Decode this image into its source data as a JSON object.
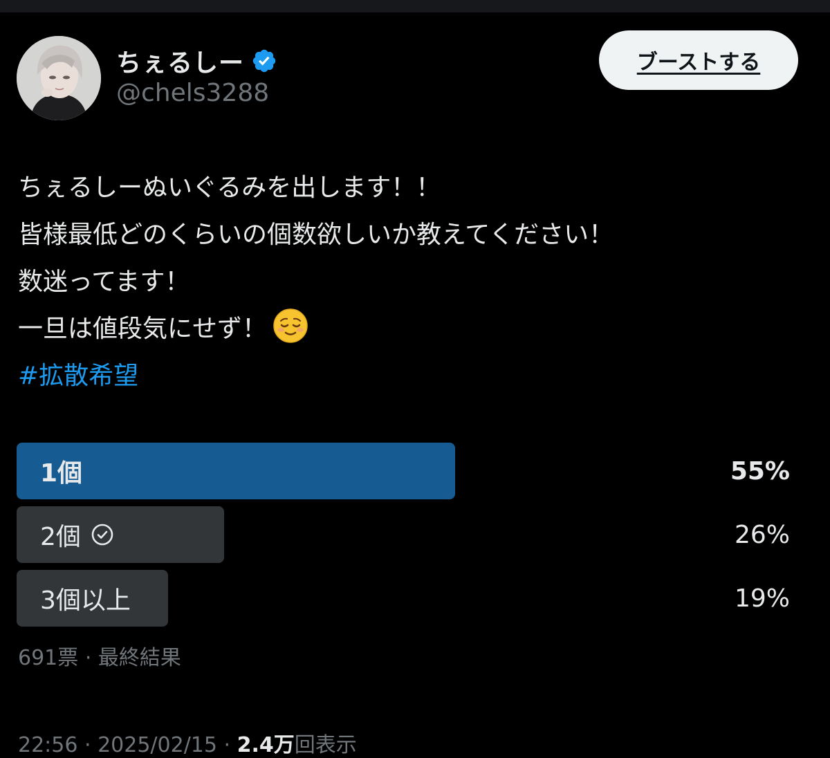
{
  "author": {
    "display_name": "ちぇるしー",
    "handle": "@chels3288",
    "verified": true,
    "avatar_icon": "user-avatar"
  },
  "actions": {
    "boost_label": "ブーストする"
  },
  "tweet": {
    "lines": [
      "ちぇるしーぬいぐるみを出します！！",
      "皆様最低どのくらいの個数欲しいか教えてください！",
      "数迷ってます！",
      "一旦は値段気にせず！"
    ],
    "emoji": "relieved-face-emoji",
    "hashtag": "#拡散希望"
  },
  "poll": {
    "options": [
      {
        "label": "1個",
        "percent": "55%",
        "fraction": 0.55,
        "leading": true,
        "voted": false
      },
      {
        "label": "2個",
        "percent": "26%",
        "fraction": 0.26,
        "leading": false,
        "voted": true
      },
      {
        "label": "3個以上",
        "percent": "19%",
        "fraction": 0.19,
        "leading": false,
        "voted": false
      }
    ],
    "votes": "691票",
    "separator": "·",
    "status": "最終結果"
  },
  "footer": {
    "timestamp": "22:56 · 2025/02/15",
    "separator": "·",
    "views_count": "2.4万",
    "views_label": "回表示"
  },
  "colors": {
    "background": "#000000",
    "accent": "#1d9bf0",
    "leading_bar": "#165b91",
    "other_bar": "#333639",
    "muted_text": "#71767b"
  }
}
